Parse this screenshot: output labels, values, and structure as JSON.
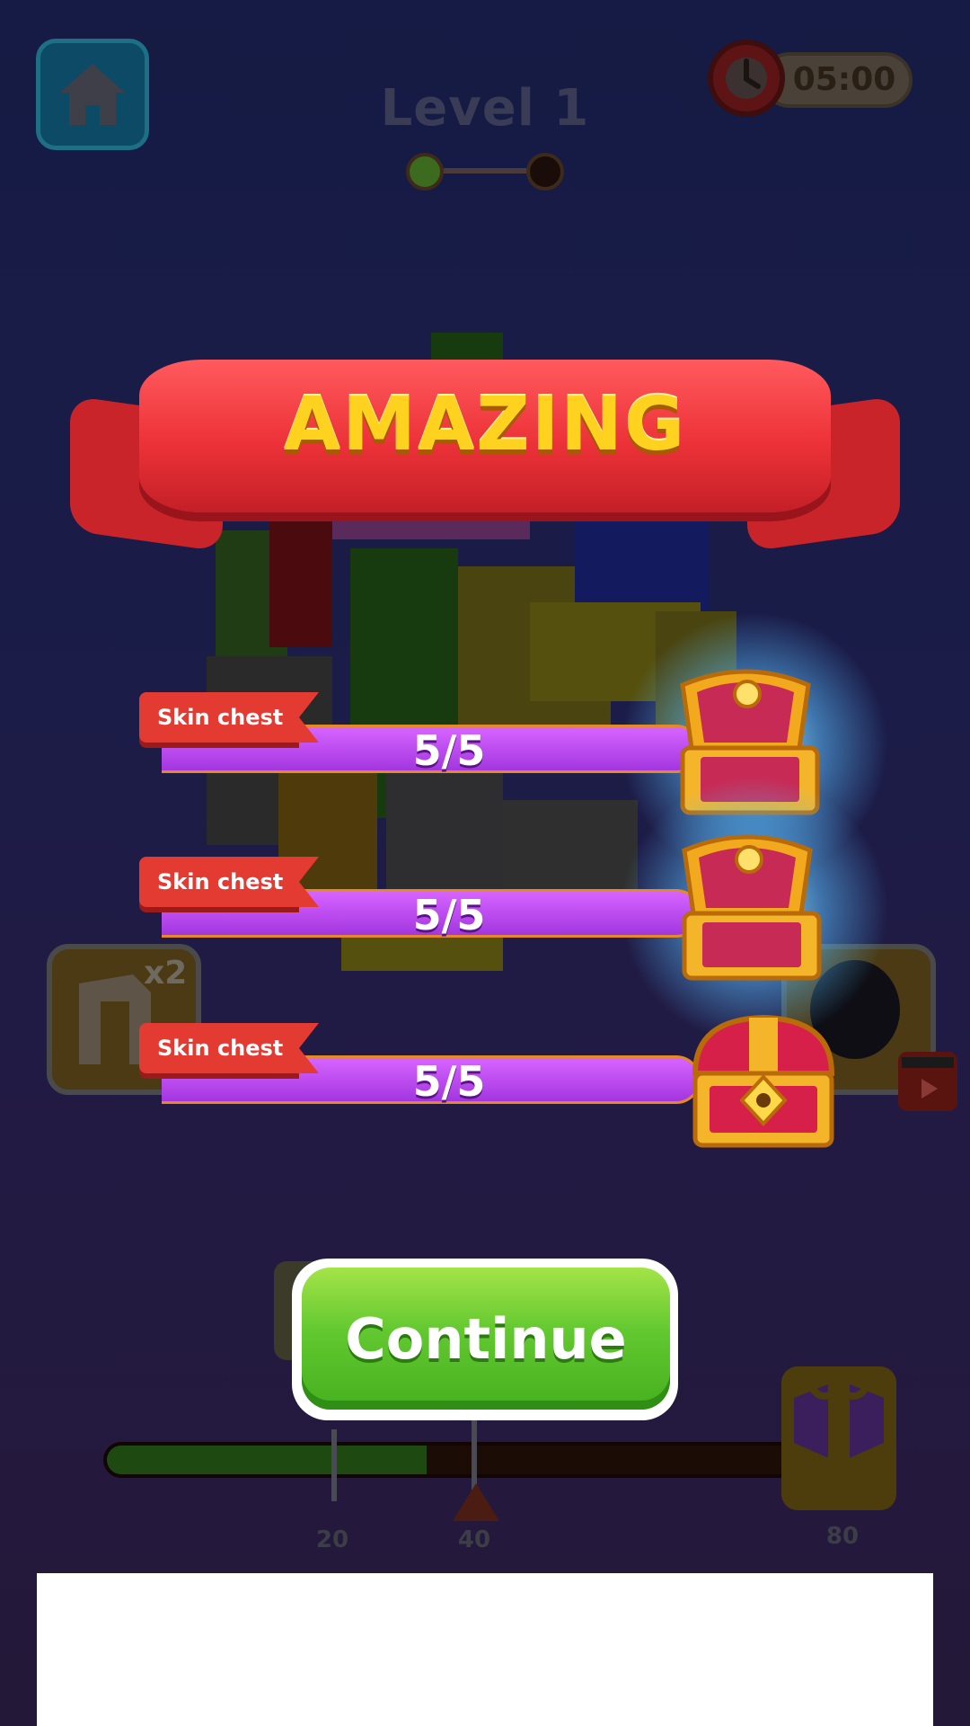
{
  "header": {
    "level_title": "Level 1",
    "timer": "05:00"
  },
  "banner": {
    "title": "AMAZING"
  },
  "rewards": [
    {
      "tag": "Skin chest",
      "progress": "5/5",
      "state": "open"
    },
    {
      "tag": "Skin chest",
      "progress": "5/5",
      "state": "open"
    },
    {
      "tag": "Skin chest",
      "progress": "5/5",
      "state": "closed"
    }
  ],
  "boosters": {
    "left_count": "x2"
  },
  "continue_button": {
    "label": "Continue"
  },
  "level_progress": {
    "fill_fraction": 0.45,
    "milestones": [
      "20",
      "40",
      "80"
    ]
  },
  "colors": {
    "banner_red": "#ec3238",
    "banner_text": "#ffd21f",
    "bar_purple": "#b847ee",
    "continue_green": "#5cc42c",
    "tag_red": "#e33a32"
  }
}
